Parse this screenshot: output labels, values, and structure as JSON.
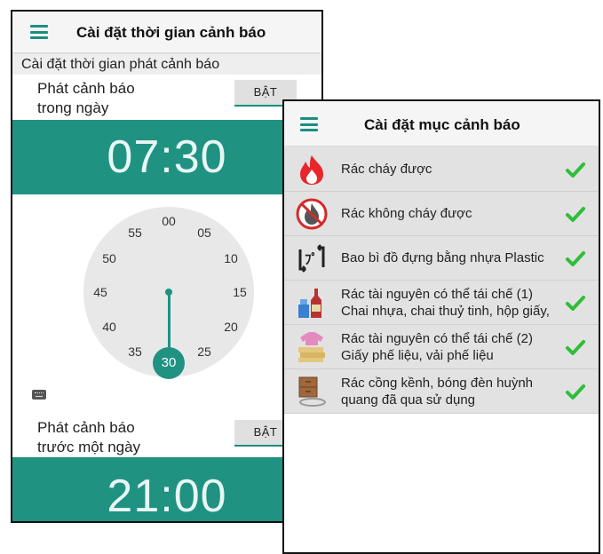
{
  "left_screen": {
    "title": "Cài đặt thời gian cảnh báo",
    "subheader": "Cài đặt thời gian phát cảnh báo",
    "alarm_same_day": {
      "label_line1": "Phát cảnh báo",
      "label_line2": "trong ngày",
      "toggle_label": "BẬT",
      "time": "07:30"
    },
    "clock": {
      "numbers": [
        "00",
        "05",
        "10",
        "15",
        "20",
        "25",
        "30",
        "35",
        "40",
        "45",
        "50",
        "55"
      ],
      "selected_minute": "30"
    },
    "alarm_day_before": {
      "label_line1": "Phát cảnh báo",
      "label_line2": "trước một ngày",
      "toggle_label": "BẬT",
      "time": "21:00"
    }
  },
  "right_screen": {
    "title": "Cài đặt mục cảnh báo",
    "items": [
      {
        "label": "Rác cháy được",
        "icon": "flame-icon",
        "checked": true
      },
      {
        "label": "Rác không cháy được",
        "icon": "no-burn-icon",
        "checked": true
      },
      {
        "label": "Bao bì đồ đựng bằng nhựa Plastic",
        "icon": "plastic-recycle-icon",
        "checked": true
      },
      {
        "label": "Rác tài nguyên có thể tái chế (1) Chai nhựa, chai thuỷ tinh, hộp giấy,",
        "icon": "bottles-icon",
        "checked": true
      },
      {
        "label": "Rác tài nguyên có thể tái chế (2) Giấy phế liệu, vải phế liệu",
        "icon": "paper-cloth-icon",
        "checked": true
      },
      {
        "label": "Rác cồng kềnh, bóng đèn huỳnh quang đã qua sử dụng",
        "icon": "bulky-waste-icon",
        "checked": true
      }
    ]
  },
  "colors": {
    "accent": "#1f9282",
    "check": "#2fbd3a"
  }
}
